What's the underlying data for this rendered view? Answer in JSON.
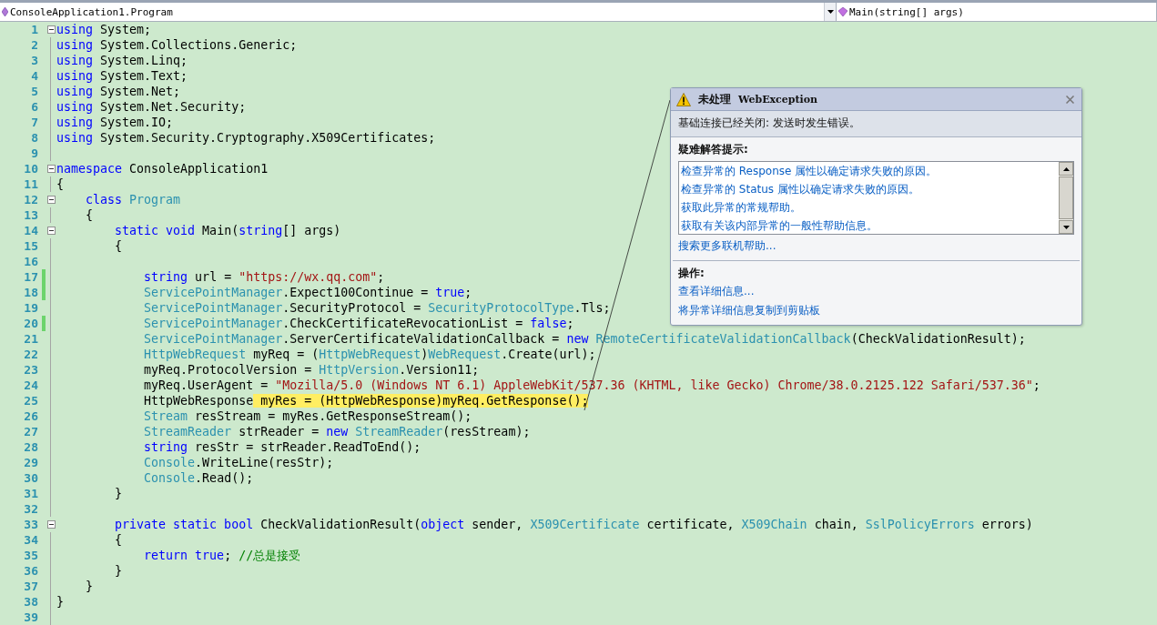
{
  "navigation_bar": {
    "type_selector": "ConsoleApplication1.Program",
    "member_selector": "Main(string[] args)"
  },
  "code_lines": [
    {
      "number": "1",
      "fold": true,
      "modified": false,
      "tokens": [
        {
          "kind": "kw",
          "text": "using"
        },
        {
          "kind": "p",
          "text": " System;"
        }
      ]
    },
    {
      "number": "2",
      "fold": false,
      "modified": false,
      "tokens": [
        {
          "kind": "kw",
          "text": "using"
        },
        {
          "kind": "p",
          "text": " System.Collections.Generic;"
        }
      ]
    },
    {
      "number": "3",
      "fold": false,
      "modified": false,
      "tokens": [
        {
          "kind": "kw",
          "text": "using"
        },
        {
          "kind": "p",
          "text": " System.Linq;"
        }
      ]
    },
    {
      "number": "4",
      "fold": false,
      "modified": false,
      "tokens": [
        {
          "kind": "kw",
          "text": "using"
        },
        {
          "kind": "p",
          "text": " System.Text;"
        }
      ]
    },
    {
      "number": "5",
      "fold": false,
      "modified": false,
      "tokens": [
        {
          "kind": "kw",
          "text": "using"
        },
        {
          "kind": "p",
          "text": " System.Net;"
        }
      ]
    },
    {
      "number": "6",
      "fold": false,
      "modified": false,
      "tokens": [
        {
          "kind": "kw",
          "text": "using"
        },
        {
          "kind": "p",
          "text": " System.Net.Security;"
        }
      ]
    },
    {
      "number": "7",
      "fold": false,
      "modified": false,
      "tokens": [
        {
          "kind": "kw",
          "text": "using"
        },
        {
          "kind": "p",
          "text": " System.IO;"
        }
      ]
    },
    {
      "number": "8",
      "fold": false,
      "modified": false,
      "tokens": [
        {
          "kind": "kw",
          "text": "using"
        },
        {
          "kind": "p",
          "text": " System.Security.Cryptography.X509Certificates;"
        }
      ]
    },
    {
      "number": "9",
      "fold": false,
      "modified": false
    },
    {
      "number": "10",
      "fold": true,
      "modified": false,
      "tokens": [
        {
          "kind": "kw",
          "text": "namespace"
        },
        {
          "kind": "p",
          "text": " ConsoleApplication1"
        }
      ]
    },
    {
      "number": "11",
      "fold": false,
      "modified": false,
      "tokens": [
        {
          "kind": "p",
          "text": "{"
        }
      ]
    },
    {
      "number": "12",
      "fold": true,
      "modified": false,
      "tokens": [
        {
          "kind": "kw",
          "text": "    class "
        },
        {
          "kind": "type",
          "text": "Program"
        }
      ]
    },
    {
      "number": "13",
      "fold": false,
      "modified": false,
      "tokens": [
        {
          "kind": "p",
          "text": "    {"
        }
      ]
    },
    {
      "number": "14",
      "fold": true,
      "modified": false,
      "tokens": [
        {
          "kind": "kw",
          "text": "        static void"
        },
        {
          "kind": "p",
          "text": " Main("
        },
        {
          "kind": "kw",
          "text": "string"
        },
        {
          "kind": "p",
          "text": "[] args)"
        }
      ]
    },
    {
      "number": "15",
      "fold": false,
      "modified": false,
      "tokens": [
        {
          "kind": "p",
          "text": "        {"
        }
      ]
    },
    {
      "number": "16",
      "fold": false,
      "modified": false
    },
    {
      "number": "17",
      "fold": false,
      "modified": true,
      "tokens": [
        {
          "kind": "kw",
          "text": "            string"
        },
        {
          "kind": "p",
          "text": " url = "
        },
        {
          "kind": "str",
          "text": "\"https://wx.qq.com\""
        },
        {
          "kind": "p",
          "text": ";"
        }
      ]
    },
    {
      "number": "18",
      "fold": false,
      "modified": true,
      "tokens": [
        {
          "kind": "type",
          "text": "            ServicePointManager"
        },
        {
          "kind": "p",
          "text": ".Expect100Continue = "
        },
        {
          "kind": "kw",
          "text": "true"
        },
        {
          "kind": "p",
          "text": ";"
        }
      ]
    },
    {
      "number": "19",
      "fold": false,
      "modified": false,
      "tokens": [
        {
          "kind": "type",
          "text": "            ServicePointManager"
        },
        {
          "kind": "p",
          "text": ".SecurityProtocol = "
        },
        {
          "kind": "type",
          "text": "SecurityProtocolType"
        },
        {
          "kind": "p",
          "text": ".Tls;"
        }
      ]
    },
    {
      "number": "20",
      "fold": false,
      "modified": true,
      "tokens": [
        {
          "kind": "type",
          "text": "            ServicePointManager"
        },
        {
          "kind": "p",
          "text": ".CheckCertificateRevocationList = "
        },
        {
          "kind": "kw",
          "text": "false"
        },
        {
          "kind": "p",
          "text": ";"
        }
      ]
    },
    {
      "number": "21",
      "fold": false,
      "modified": false,
      "tokens": [
        {
          "kind": "type",
          "text": "            ServicePointManager"
        },
        {
          "kind": "p",
          "text": ".ServerCertificateValidationCallback = "
        },
        {
          "kind": "kw",
          "text": "new "
        },
        {
          "kind": "type",
          "text": "RemoteCertificateValidationCallback"
        },
        {
          "kind": "p",
          "text": "(CheckValidationResult);"
        }
      ]
    },
    {
      "number": "22",
      "fold": false,
      "modified": false,
      "tokens": [
        {
          "kind": "type",
          "text": "            HttpWebRequest"
        },
        {
          "kind": "p",
          "text": " myReq = ("
        },
        {
          "kind": "type",
          "text": "HttpWebRequest"
        },
        {
          "kind": "p",
          "text": ")"
        },
        {
          "kind": "type",
          "text": "WebRequest"
        },
        {
          "kind": "p",
          "text": ".Create(url);"
        }
      ]
    },
    {
      "number": "23",
      "fold": false,
      "modified": false,
      "tokens": [
        {
          "kind": "p",
          "text": "            myReq.ProtocolVersion = "
        },
        {
          "kind": "type",
          "text": "HttpVersion"
        },
        {
          "kind": "p",
          "text": ".Version11;"
        }
      ]
    },
    {
      "number": "24",
      "fold": false,
      "modified": false,
      "tokens": [
        {
          "kind": "p",
          "text": "            myReq.UserAgent = "
        },
        {
          "kind": "str",
          "text": "\"Mozilla/5.0 (Windows NT 6.1) AppleWebKit/537.36 (KHTML, like Gecko) Chrome/38.0.2125.122 Safari/537.36\""
        },
        {
          "kind": "p",
          "text": ";"
        }
      ]
    },
    {
      "number": "25",
      "fold": false,
      "modified": false,
      "tokens": [
        {
          "kind": "p",
          "text": "            HttpWebResponse"
        },
        {
          "kind": "hl",
          "text": " myRes = (HttpWebResponse)myReq.GetResponse();"
        }
      ]
    },
    {
      "number": "26",
      "fold": false,
      "modified": false,
      "tokens": [
        {
          "kind": "type",
          "text": "            Stream"
        },
        {
          "kind": "p",
          "text": " resStream = myRes.GetResponseStream();"
        }
      ]
    },
    {
      "number": "27",
      "fold": false,
      "modified": false,
      "tokens": [
        {
          "kind": "type",
          "text": "            StreamReader"
        },
        {
          "kind": "p",
          "text": " strReader = "
        },
        {
          "kind": "kw",
          "text": "new "
        },
        {
          "kind": "type",
          "text": "StreamReader"
        },
        {
          "kind": "p",
          "text": "(resStream);"
        }
      ]
    },
    {
      "number": "28",
      "fold": false,
      "modified": false,
      "tokens": [
        {
          "kind": "kw",
          "text": "            string"
        },
        {
          "kind": "p",
          "text": " resStr = strReader.ReadToEnd();"
        }
      ]
    },
    {
      "number": "29",
      "fold": false,
      "modified": false,
      "tokens": [
        {
          "kind": "type",
          "text": "            Console"
        },
        {
          "kind": "p",
          "text": ".WriteLine(resStr);"
        }
      ]
    },
    {
      "number": "30",
      "fold": false,
      "modified": false,
      "tokens": [
        {
          "kind": "type",
          "text": "            Console"
        },
        {
          "kind": "p",
          "text": ".Read();"
        }
      ]
    },
    {
      "number": "31",
      "fold": false,
      "modified": false,
      "tokens": [
        {
          "kind": "p",
          "text": "        }"
        }
      ]
    },
    {
      "number": "32",
      "fold": false,
      "modified": false
    },
    {
      "number": "33",
      "fold": true,
      "modified": false,
      "tokens": [
        {
          "kind": "kw",
          "text": "        private static bool"
        },
        {
          "kind": "p",
          "text": " CheckValidationResult("
        },
        {
          "kind": "kw",
          "text": "object"
        },
        {
          "kind": "p",
          "text": " sender, "
        },
        {
          "kind": "type",
          "text": "X509Certificate"
        },
        {
          "kind": "p",
          "text": " certificate, "
        },
        {
          "kind": "type",
          "text": "X509Chain"
        },
        {
          "kind": "p",
          "text": " chain, "
        },
        {
          "kind": "type",
          "text": "SslPolicyErrors"
        },
        {
          "kind": "p",
          "text": " errors)"
        }
      ]
    },
    {
      "number": "34",
      "fold": false,
      "modified": false,
      "tokens": [
        {
          "kind": "p",
          "text": "        {"
        }
      ]
    },
    {
      "number": "35",
      "fold": false,
      "modified": false,
      "tokens": [
        {
          "kind": "kw",
          "text": "            return true"
        },
        {
          "kind": "p",
          "text": "; "
        },
        {
          "kind": "cm",
          "text": "//总是接受"
        }
      ]
    },
    {
      "number": "36",
      "fold": false,
      "modified": false,
      "tokens": [
        {
          "kind": "p",
          "text": "        }"
        }
      ]
    },
    {
      "number": "37",
      "fold": false,
      "modified": false,
      "tokens": [
        {
          "kind": "p",
          "text": "    }"
        }
      ]
    },
    {
      "number": "38",
      "fold": false,
      "modified": false,
      "tokens": [
        {
          "kind": "p",
          "text": "}"
        }
      ]
    },
    {
      "number": "39",
      "fold": false,
      "modified": false
    }
  ],
  "exception_popup": {
    "title": "未处理",
    "exception_type": "WebException",
    "message": "基础连接已经关闭: 发送时发生错误。",
    "tips_heading": "疑难解答提示:",
    "tips": [
      "检查异常的 Response 属性以确定请求失败的原因。",
      "检查异常的 Status 属性以确定请求失败的原因。",
      "获取此异常的常规帮助。",
      "获取有关该内部异常的一般性帮助信息。"
    ],
    "search_link": "搜索更多联机帮助...",
    "actions_heading": "操作:",
    "actions": [
      "查看详细信息...",
      "将异常详细信息复制到剪贴板"
    ]
  }
}
